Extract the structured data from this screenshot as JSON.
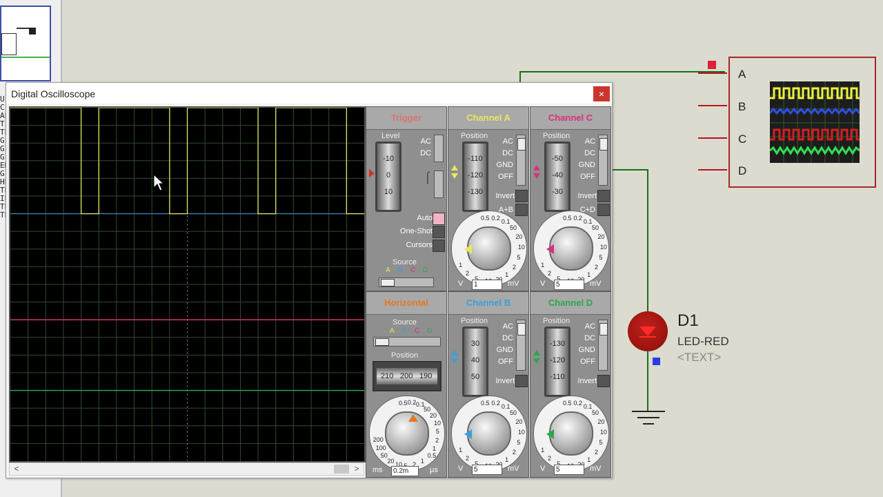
{
  "window": {
    "title": "Digital Oscilloscope",
    "close_glyph": "×"
  },
  "left_strip_letters": [
    "U",
    "C",
    "AL",
    "T",
    "TE",
    "G",
    "GI",
    "G",
    "EN",
    "G",
    "HE",
    "TE",
    "IE",
    "TE",
    "TE"
  ],
  "trigger": {
    "title": "Trigger",
    "level_label": "Level",
    "drum_values": [
      "-10",
      "0",
      "10"
    ],
    "coupling": [
      "AC",
      "DC"
    ],
    "modes": [
      "Auto",
      "One-Shot",
      "Cursors"
    ],
    "source_label": "Source",
    "source_letters": [
      "A",
      "B",
      "C",
      "D"
    ]
  },
  "channel_a": {
    "title": "Channel A",
    "position_label": "Position",
    "drum_values": [
      "-110",
      "-120",
      "-130"
    ],
    "modes": [
      "AC",
      "DC",
      "GND",
      "OFF"
    ],
    "invert_label": "Invert",
    "combine_label": "A+B",
    "unit_left": "V",
    "unit_right": "mV",
    "value": "1",
    "scale": [
      "0.5",
      "0.2",
      "0.1",
      "50",
      "20",
      "10",
      "5",
      "2",
      "1",
      "20",
      "10",
      "5",
      "2",
      "1"
    ]
  },
  "channel_c": {
    "title": "Channel C",
    "position_label": "Position",
    "drum_values": [
      "-50",
      "-40",
      "-30"
    ],
    "modes": [
      "AC",
      "DC",
      "GND",
      "OFF"
    ],
    "invert_label": "Invert",
    "combine_label": "C+D",
    "unit_left": "V",
    "unit_right": "mV",
    "value": "5",
    "scale": [
      "0.5",
      "0.2",
      "0.1",
      "50",
      "20",
      "10",
      "5",
      "2",
      "1",
      "20",
      "10",
      "5",
      "2",
      "1"
    ]
  },
  "horizontal": {
    "title": "Horizontal",
    "source_label": "Source",
    "source_letters": [
      "A",
      "B",
      "C",
      "D"
    ],
    "position_label": "Position",
    "position_values": [
      "210",
      "200",
      "190"
    ],
    "unit_left": "ms",
    "unit_right": "μs",
    "value": "0.2m",
    "scale": [
      "0.5",
      "0.2",
      "0.1",
      "50",
      "20",
      "10",
      "5",
      "2",
      "1",
      "0.5",
      "1",
      "2",
      "5",
      "10",
      "20",
      "50",
      "100",
      "200"
    ]
  },
  "channel_b": {
    "title": "Channel B",
    "position_label": "Position",
    "drum_values": [
      "30",
      "40",
      "50"
    ],
    "modes": [
      "AC",
      "DC",
      "GND",
      "OFF"
    ],
    "invert_label": "Invert",
    "unit_left": "V",
    "unit_right": "mV",
    "value": "5",
    "scale": [
      "0.5",
      "0.2",
      "0.1",
      "50",
      "20",
      "10",
      "5",
      "2",
      "1",
      "20",
      "10",
      "5",
      "2",
      "1"
    ]
  },
  "channel_d": {
    "title": "Channel D",
    "position_label": "Position",
    "drum_values": [
      "-130",
      "-120",
      "-110"
    ],
    "modes": [
      "AC",
      "DC",
      "GND",
      "OFF"
    ],
    "invert_label": "Invert",
    "unit_left": "V",
    "unit_right": "mV",
    "value": "5",
    "scale": [
      "0.5",
      "0.2",
      "0.1",
      "50",
      "20",
      "10",
      "5",
      "2",
      "1",
      "20",
      "10",
      "5",
      "2",
      "1"
    ]
  },
  "colors": {
    "channel_a": "#e8e860",
    "channel_b": "#3aa0d8",
    "channel_c": "#d8307a",
    "channel_d": "#2aa84a",
    "trigger": "#e07070",
    "horizontal": "#e07a20",
    "wire": "#1a6e1a",
    "pin": "#b01818"
  },
  "traces": {
    "a_square_wave": {
      "high_divisions": 2.4,
      "period_divisions": 5,
      "duty": 0.8
    },
    "b_level_divisions": 0,
    "c_level_divisions": -2.0,
    "d_level_divisions": -4.0
  },
  "schematic": {
    "scope_pins": [
      "A",
      "B",
      "C",
      "D"
    ],
    "led_ref": "D1",
    "led_value": "LED-RED",
    "led_text": "<TEXT>"
  }
}
